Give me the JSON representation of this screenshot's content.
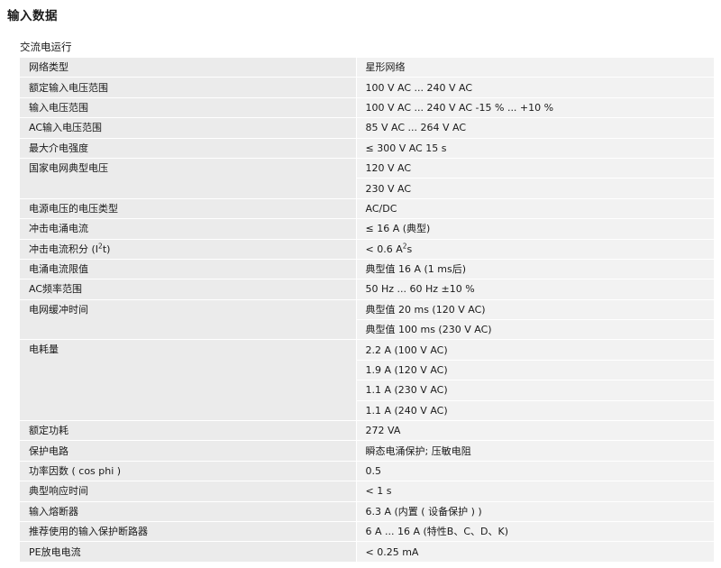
{
  "page": {
    "title": "输入数据",
    "section": "交流电运行"
  },
  "rows": [
    {
      "label": "网络类型",
      "values": [
        "星形网络"
      ]
    },
    {
      "label": "额定输入电压范围",
      "values": [
        "100 V AC ... 240 V AC"
      ]
    },
    {
      "label": "输入电压范围",
      "values": [
        "100 V AC ... 240 V AC -15 % ... +10 %"
      ]
    },
    {
      "label": "AC输入电压范围",
      "values": [
        "85 V AC ... 264 V AC"
      ]
    },
    {
      "label": "最大介电强度",
      "values": [
        "≤ 300 V AC 15 s"
      ]
    },
    {
      "label": "国家电网典型电压",
      "values": [
        "120 V AC",
        "230 V AC"
      ]
    },
    {
      "label": "电源电压的电压类型",
      "values": [
        "AC/DC"
      ]
    },
    {
      "label": "冲击电涌电流",
      "values": [
        "≤ 16 A (典型)"
      ]
    },
    {
      "label": "冲击电流积分 (I²t)",
      "label_parts": [
        "冲击电流积分 (I",
        "2",
        "t)"
      ],
      "values": [
        "< 0.6 A²s"
      ],
      "value_parts": [
        "< 0.6 A",
        "2",
        "s"
      ]
    },
    {
      "label": "电涌电流限值",
      "values": [
        "典型值 16 A (1 ms后)"
      ]
    },
    {
      "label": "AC频率范围",
      "values": [
        "50 Hz ... 60 Hz ±10 %"
      ]
    },
    {
      "label": "电网缓冲时间",
      "values": [
        "典型值 20 ms (120 V AC)",
        "典型值 100 ms (230 V AC)"
      ]
    },
    {
      "label": "电耗量",
      "values": [
        "2.2 A (100 V AC)",
        "1.9 A (120 V AC)",
        "1.1 A (230 V AC)",
        "1.1 A (240 V AC)"
      ]
    },
    {
      "label": "额定功耗",
      "values": [
        "272 VA"
      ]
    },
    {
      "label": "保护电路",
      "values": [
        "瞬态电涌保护; 压敏电阻"
      ]
    },
    {
      "label": "功率因数 ( cos phi )",
      "values": [
        "0.5"
      ]
    },
    {
      "label": "典型响应时间",
      "values": [
        "< 1 s"
      ]
    },
    {
      "label": "输入熔断器",
      "values": [
        "6.3 A (内置 ( 设备保护 ) )"
      ]
    },
    {
      "label": "推荐使用的输入保护断路器",
      "values": [
        "6 A ... 16 A (特性B、C、D、K)"
      ]
    },
    {
      "label": "PE放电电流",
      "values": [
        "< 0.25 mA"
      ]
    }
  ]
}
